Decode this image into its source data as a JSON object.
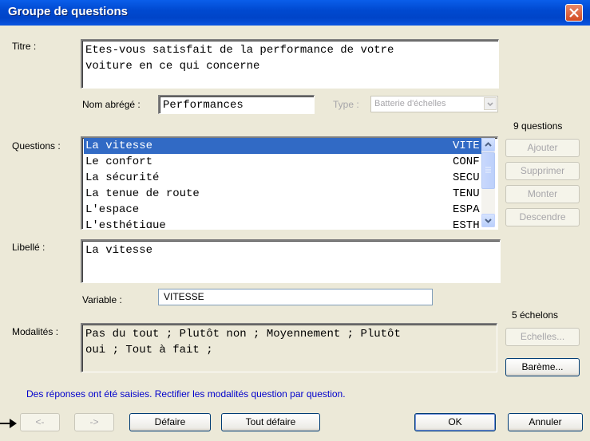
{
  "window": {
    "title": "Groupe de questions"
  },
  "labels": {
    "titre": "Titre :",
    "nom_abrege": "Nom abrégé :",
    "type": "Type :",
    "questions": "Questions :",
    "libelle": "Libellé :",
    "variable": "Variable :",
    "modalites": "Modalités :"
  },
  "fields": {
    "titre_value": "Etes-vous satisfait de la performance de votre\nvoiture en ce qui concerne",
    "nom_abrege_value": "Performances",
    "type_value": "Batterie d'échelles",
    "libelle_value": "La vitesse",
    "variable_value": "VITESSE",
    "modalites_value": "Pas du tout ; Plutôt non ; Moyennement ; Plutôt\noui ; Tout à fait ;"
  },
  "questions": {
    "count_label": "9 questions",
    "items": [
      {
        "text": "La vitesse",
        "code": "VITE",
        "selected": true
      },
      {
        "text": "Le confort",
        "code": "CONF"
      },
      {
        "text": "La sécurité",
        "code": "SECU"
      },
      {
        "text": "La tenue de route",
        "code": "TENU"
      },
      {
        "text": "L'espace",
        "code": "ESPA"
      },
      {
        "text": "L'esthétique",
        "code": "ESTH"
      }
    ]
  },
  "side_buttons": {
    "ajouter": "Ajouter",
    "supprimer": "Supprimer",
    "monter": "Monter",
    "descendre": "Descendre"
  },
  "echelons": {
    "count_label": "5 échelons",
    "echelles": "Echelles...",
    "bareme": "Barème..."
  },
  "notice": "Des réponses ont été saisies. Rectifier les modalités question par question.",
  "footer": {
    "prev": "<-",
    "next": "->",
    "defaire": "Défaire",
    "tout_defaire": "Tout défaire",
    "ok": "OK",
    "annuler": "Annuler"
  },
  "colors": {
    "selection": "#316AC5",
    "notice": "#0000CC",
    "dialog_bg": "#ECE9D8"
  }
}
